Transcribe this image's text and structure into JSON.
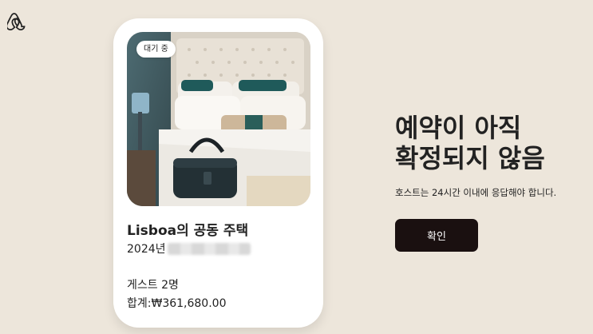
{
  "brand": {
    "logo_icon": "airbnb-logo-icon"
  },
  "listing": {
    "status_badge": "대기 중",
    "title": "Lisboa의 공동 주택",
    "date_prefix": "2024년",
    "guests": "게스트 2명",
    "total": "합계:₩361,680.00",
    "photo_icon": "bedroom-photo"
  },
  "status": {
    "headline_line1": "예약이 아직",
    "headline_line2": "확정되지 않음",
    "message": "호스트는 24시간 이내에 응답해야 합니다.",
    "confirm_label": "확인"
  },
  "colors": {
    "background": "#ede6db",
    "button": "#1a1010",
    "text": "#222222"
  }
}
